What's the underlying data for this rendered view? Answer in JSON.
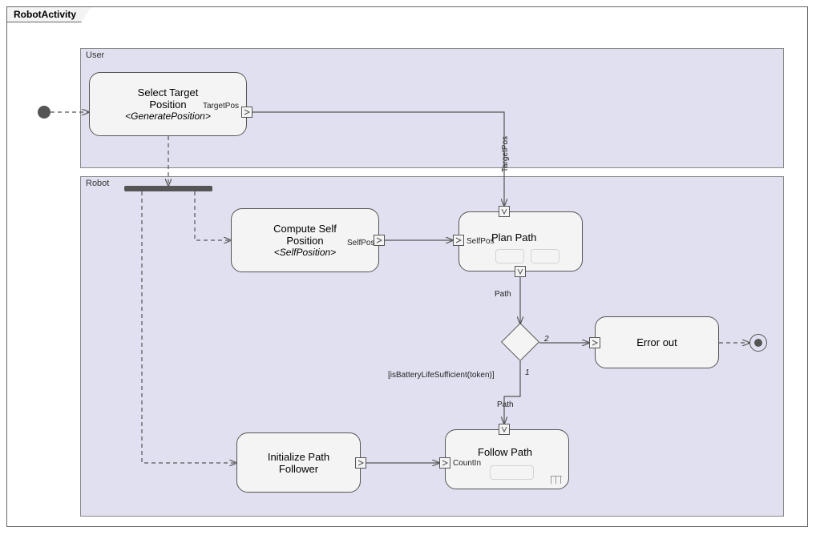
{
  "diagram": {
    "title": "RobotActivity",
    "swimlanes": {
      "user": {
        "label": "User"
      },
      "robot": {
        "label": "Robot"
      }
    },
    "nodes": {
      "select_target": {
        "title": "Select Target\nPosition",
        "behavior": "<GeneratePosition>",
        "outPin": "TargetPos"
      },
      "compute_self": {
        "title": "Compute Self\nPosition",
        "behavior": "<SelfPosition>",
        "outPin": "SelfPos"
      },
      "plan_path": {
        "title": "Plan Path",
        "inPinTop": "TargetPos",
        "inPinLeft": "SelfPos",
        "outPinBottom": "Path"
      },
      "error_out": {
        "title": "Error out"
      },
      "init_path": {
        "title": "Initialize Path\nFollower"
      },
      "follow_path": {
        "title": "Follow Path",
        "inPinTop": "Path",
        "inPinLeft": "CountIn"
      },
      "decision": {
        "guard": "[isBatteryLifeSufficient(token)]",
        "edge1": "1",
        "edge2": "2"
      }
    }
  }
}
